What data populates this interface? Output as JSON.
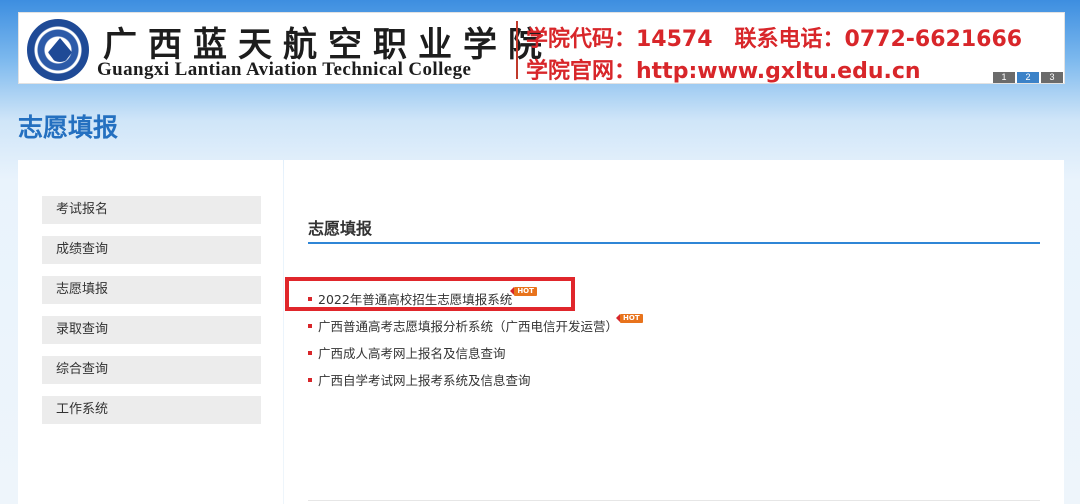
{
  "banner": {
    "college_name_cn": "广西蓝天航空职业学院",
    "college_name_en": "Guangxi Lantian Aviation Technical College",
    "code_line": "学院代码：14574　联系电话：0772-6621666",
    "website_line": "学院官网：http:www.gxltu.edu.cn",
    "pager": [
      "1",
      "2",
      "3"
    ],
    "active_page": "2"
  },
  "page_title": "志愿填报",
  "sidebar": {
    "items": [
      {
        "label": "考试报名"
      },
      {
        "label": "成绩查询"
      },
      {
        "label": "志愿填报"
      },
      {
        "label": "录取查询"
      },
      {
        "label": "综合查询"
      },
      {
        "label": "工作系统"
      }
    ]
  },
  "main": {
    "title": "志愿填报",
    "links": [
      {
        "label": "2022年普通高校招生志愿填报系统",
        "badge": "HOT"
      },
      {
        "label": "广西普通高考志愿填报分析系统（广西电信开发运营）",
        "badge": "HOT"
      },
      {
        "label": "广西成人高考网上报名及信息查询",
        "badge": ""
      },
      {
        "label": "广西自学考试网上报考系统及信息查询",
        "badge": ""
      }
    ]
  },
  "colors": {
    "accent_blue": "#2470c0",
    "brand_red": "#d8262a",
    "hot_badge": "#e8731c",
    "highlight_box": "#e0262b"
  },
  "icons": {
    "logo": "college-emblem-icon",
    "bullet": "square-bullet-icon",
    "hot": "hot-badge-icon"
  }
}
